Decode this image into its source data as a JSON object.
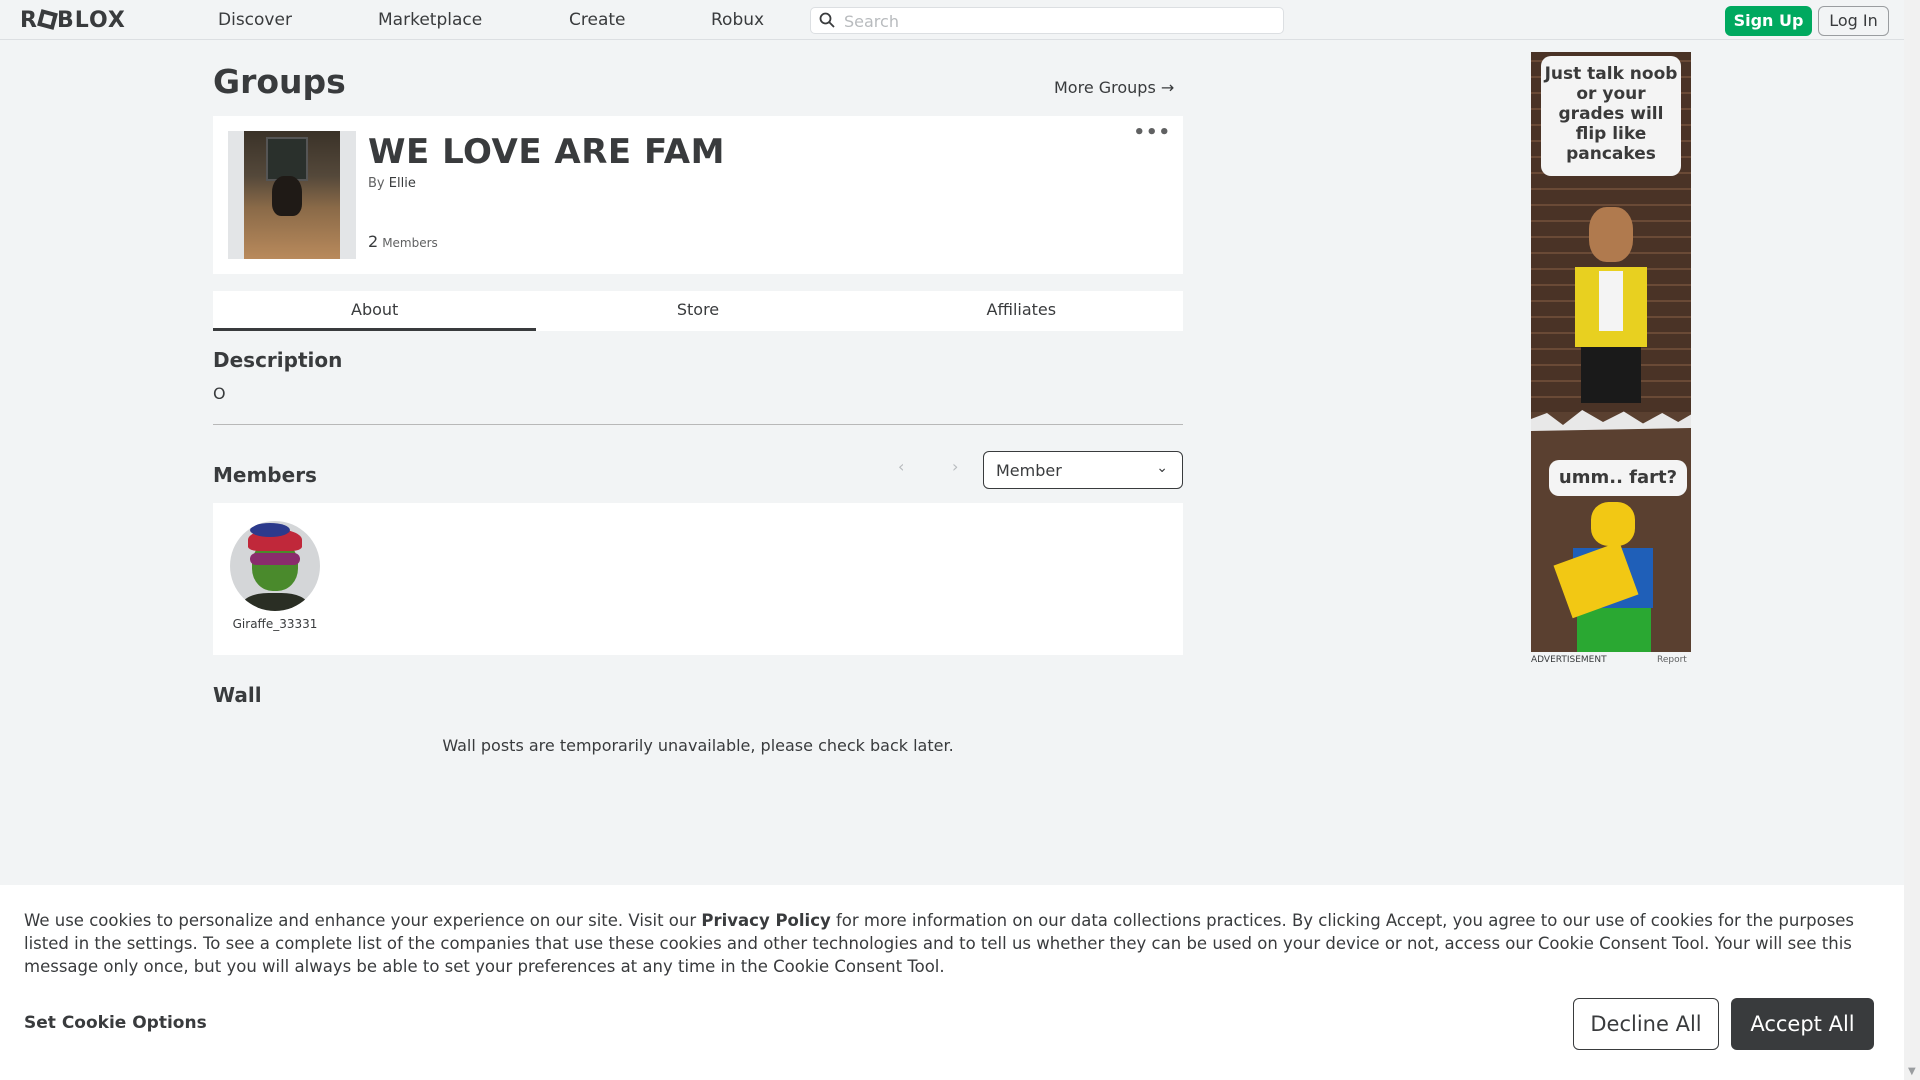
{
  "header": {
    "logo": "ROBLOX",
    "nav": [
      "Discover",
      "Marketplace",
      "Create",
      "Robux"
    ],
    "search_placeholder": "Search",
    "signup": "Sign Up",
    "login": "Log In"
  },
  "page": {
    "title": "Groups",
    "more_groups": "More Groups →"
  },
  "group": {
    "name": "WE LOVE ARE FAM",
    "by_label": "By",
    "owner": "Ellie",
    "member_count": "2",
    "members_label": "Members",
    "menu_icon": "more-dots-icon"
  },
  "tabs": [
    "About",
    "Store",
    "Affiliates"
  ],
  "active_tab": "About",
  "description": {
    "title": "Description",
    "text": "O"
  },
  "members": {
    "title": "Members",
    "role_filter": "Member",
    "list": [
      {
        "name": "Giraffe_33331"
      }
    ]
  },
  "wall": {
    "title": "Wall",
    "message": "Wall posts are temporarily unavailable, please check back later."
  },
  "ad": {
    "bubble1": "Just talk noob or your grades will flip like pancakes",
    "bubble2": "umm.. fart?",
    "label": "ADVERTISEMENT",
    "report": "Report"
  },
  "cookie": {
    "text_before": "We use cookies to personalize and enhance your experience on our site. Visit our ",
    "privacy_link": "Privacy Policy",
    "text_after": " for more information on our data collections practices. By clicking Accept, you agree to our use of cookies for the purposes listed in the settings. To see a complete list of the companies that use these cookies and other technologies and to tell us whether they can be used on your device or not, access our Cookie Consent Tool. Your will see this message only once, but you will always be able to set your preferences at any time in the Cookie Consent Tool.",
    "options": "Set Cookie Options",
    "decline": "Decline All",
    "accept": "Accept All"
  },
  "colors": {
    "signup_green": "#00a95f",
    "accept_dark": "#393b3d",
    "background": "#f2f4f5"
  }
}
